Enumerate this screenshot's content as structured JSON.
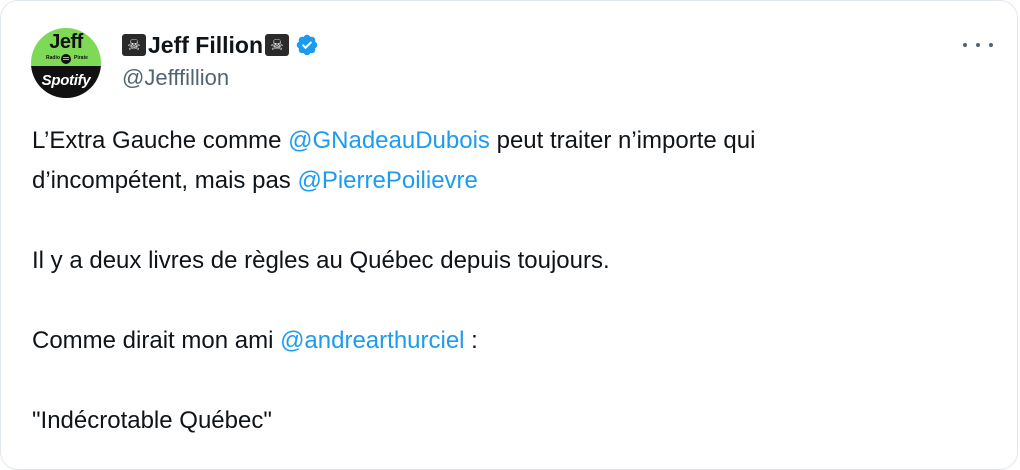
{
  "author": {
    "avatar_text_top": "Jeff",
    "avatar_text_mini_left": "Radio",
    "avatar_text_mini_right": "Pirate",
    "avatar_text_bottom": "Spotify",
    "emoji_left": "☠",
    "display_name": "Jeff Fillion",
    "emoji_right": "☠",
    "handle": "@Jefffillion",
    "verified_icon": "verified-badge-icon"
  },
  "tweet": {
    "line1_before": "L’Extra Gauche comme ",
    "line1_mention": "@GNadeauDubois",
    "line1_after": " peut traiter n’importe qui",
    "line2_before": "d’incompétent, mais pas ",
    "line2_mention": "@PierrePoilievre",
    "para2": "Il y a deux livres de règles au Québec depuis toujours.",
    "para3_before": "Comme dirait mon ami ",
    "para3_mention": "@andrearthurciel",
    "para3_after": " :",
    "para4": "\"Indécrotable Québec\""
  },
  "colors": {
    "link": "#1d9bf0",
    "text": "#0f1419",
    "secondary": "#536471",
    "avatar_green": "#7ed957"
  },
  "menu_icon": "more-dots-icon"
}
